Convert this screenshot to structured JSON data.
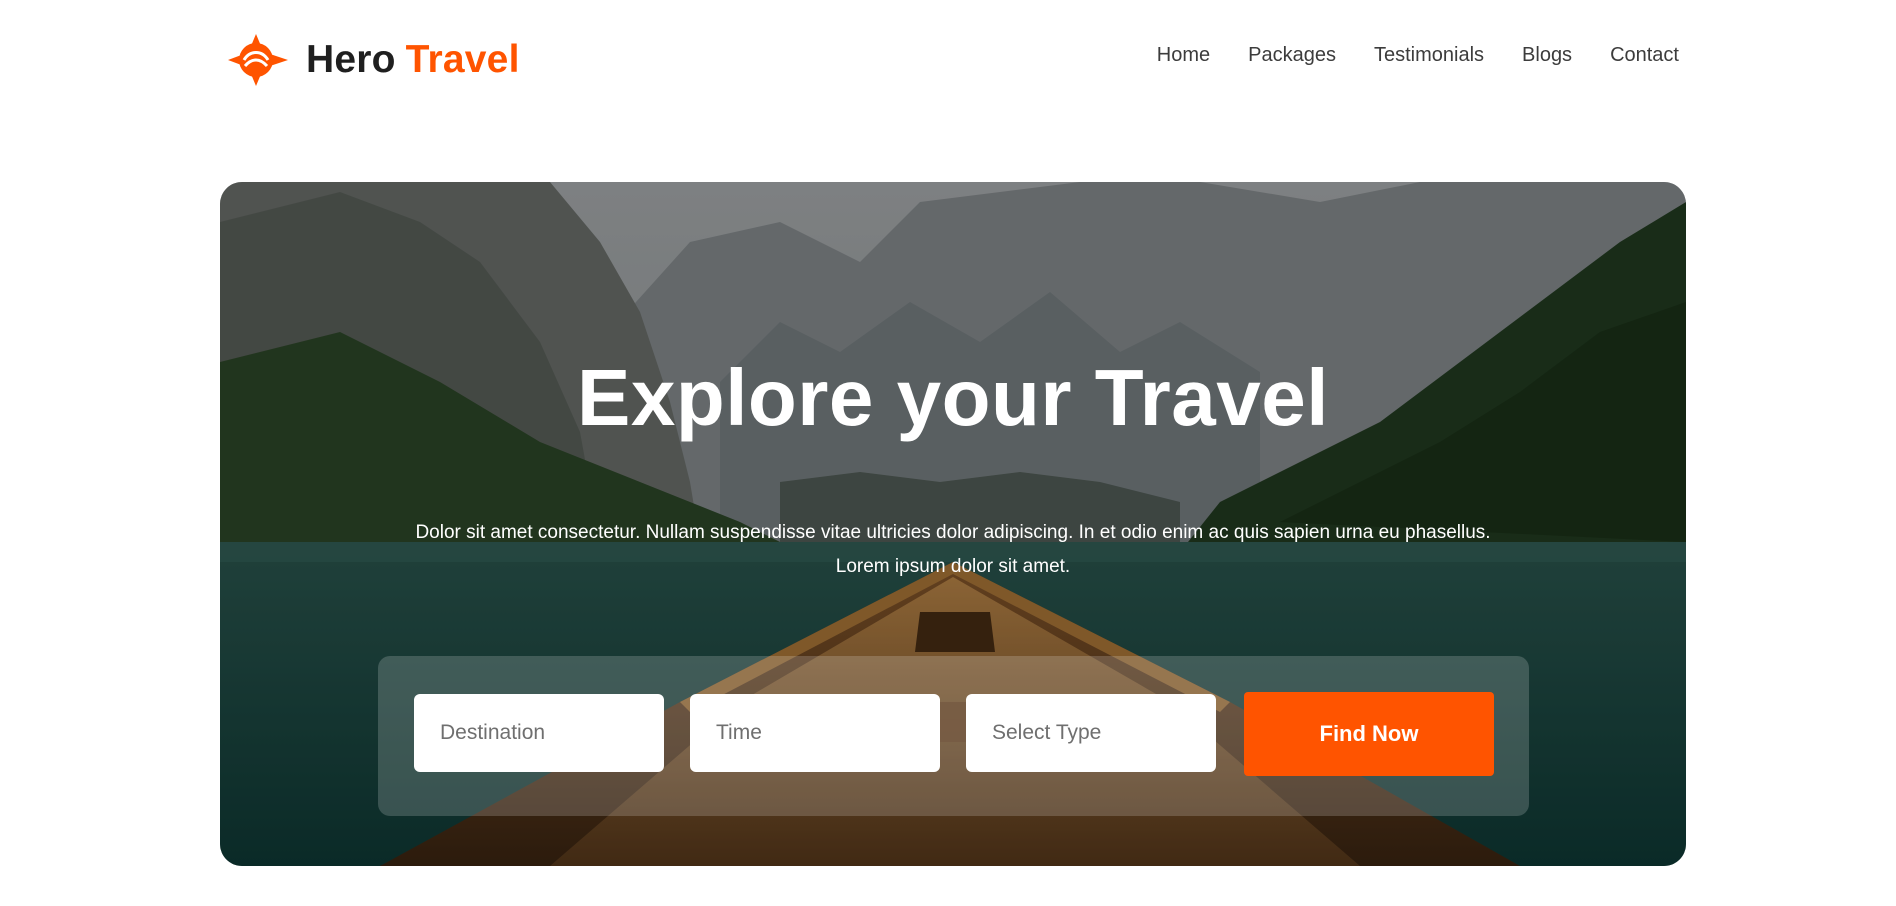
{
  "brand": {
    "name_part1": "Hero",
    "name_part2": "Travel",
    "accent_color": "#ff5400",
    "logo_icon": "compass-crosshair-icon"
  },
  "nav": {
    "items": [
      "Home",
      "Packages",
      "Testimonials",
      "Blogs",
      "Contact"
    ]
  },
  "hero": {
    "title": "Explore your Travel",
    "description": "Dolor sit amet consectetur. Nullam suspendisse vitae ultricies dolor adipiscing. In et odio enim ac quis sapien urna eu phasellus. Lorem ipsum dolor sit amet.",
    "background": "mountain-lake-boat-photo"
  },
  "search": {
    "destination_placeholder": "Destination",
    "time_placeholder": "Time",
    "type_placeholder": "Select Type",
    "button_label": "Find Now"
  }
}
